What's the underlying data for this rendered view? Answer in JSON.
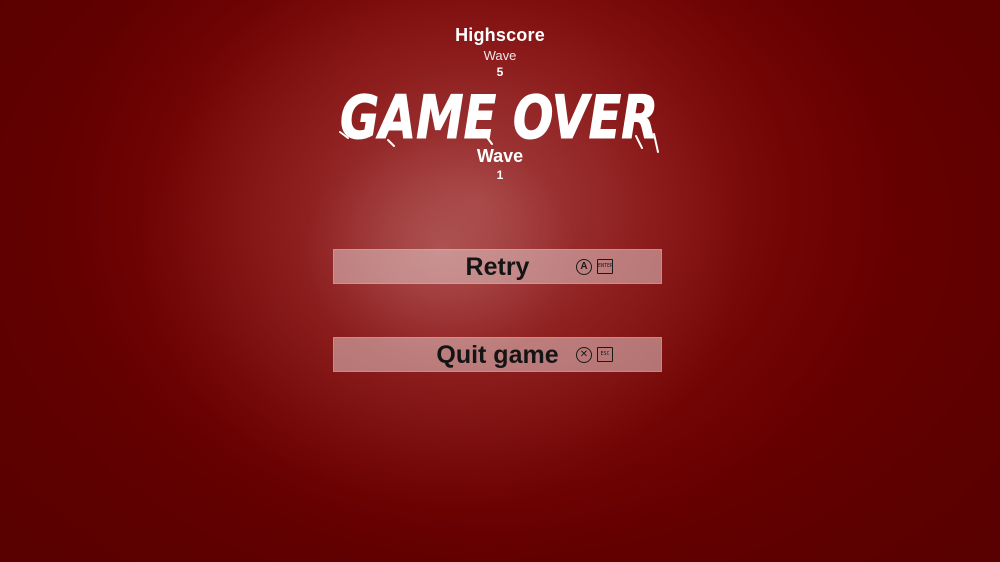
{
  "highscore": {
    "title": "Highscore",
    "label": "Wave",
    "value": "5"
  },
  "game_over": {
    "text": "GAME OVER"
  },
  "current": {
    "label": "Wave",
    "value": "1"
  },
  "menu": {
    "retry": {
      "label": "Retry",
      "gamepad_hint": "A",
      "key_hint": "ENTER"
    },
    "quit": {
      "label": "Quit game",
      "gamepad_hint": "✕",
      "key_hint": "ESC"
    }
  },
  "colors": {
    "background": "#6a0000",
    "glow": "#a23c3c",
    "button": "#d9bcbc",
    "text_light": "#ffffff",
    "text_dark": "#141414"
  },
  "icons": {
    "gamepad_a": "gamepad-a-icon",
    "gamepad_x": "gamepad-x-icon",
    "enter_key": "enter-key-icon",
    "esc_key": "esc-key-icon"
  }
}
